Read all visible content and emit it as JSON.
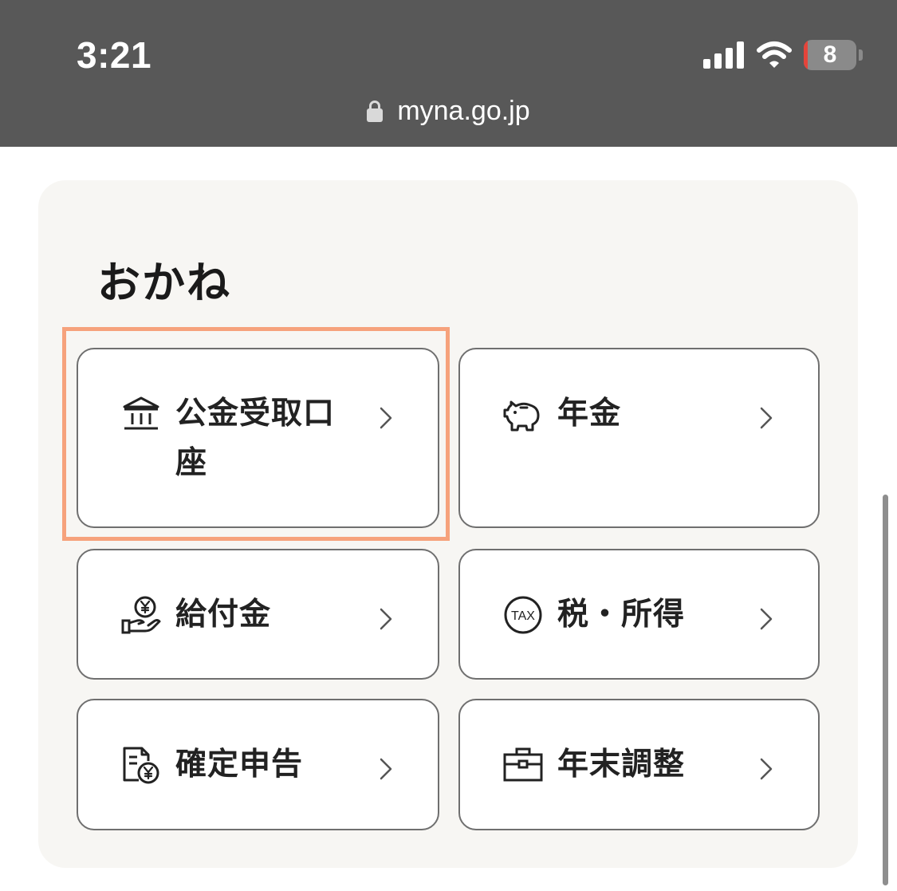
{
  "status_bar": {
    "time": "3:21",
    "battery_percent": 8,
    "battery_label": "8",
    "signal_bars": 4,
    "icons": [
      "signal-bars-icon",
      "wifi-icon",
      "battery-icon"
    ]
  },
  "browser": {
    "url": "myna.go.jp",
    "secure_icon": "lock-icon"
  },
  "section": {
    "title": "おかね",
    "tiles": [
      {
        "label_line1": "公金受取口",
        "label_line2": "座",
        "icon": "bank-icon",
        "highlighted": true
      },
      {
        "label_line1": "年金",
        "icon": "piggy-bank-icon"
      },
      {
        "label_line1": "給付金",
        "icon": "hand-yen-coin-icon"
      },
      {
        "label_line1": "税・所得",
        "icon": "tax-icon",
        "icon_text": "TAX"
      },
      {
        "label_line1": "確定申告",
        "icon": "tax-return-document-icon"
      },
      {
        "label_line1": "年末調整",
        "icon": "briefcase-icon"
      }
    ]
  },
  "colors": {
    "status_bar_bg": "#585858",
    "card_bg": "#f7f6f3",
    "highlight": "#f6a27c",
    "battery_low": "#e5443a",
    "tile_border": "#6f6f6f"
  }
}
